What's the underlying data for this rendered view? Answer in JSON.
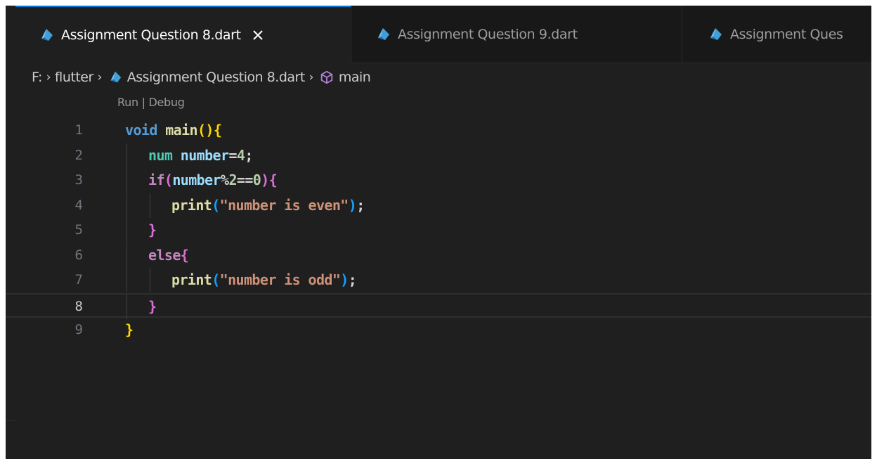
{
  "tabs": [
    {
      "label": "Assignment Question 8.dart",
      "active": true,
      "close_glyph": "✕"
    },
    {
      "label": "Assignment Question 9.dart",
      "active": false
    },
    {
      "label": "Assignment Ques",
      "active": false
    }
  ],
  "breadcrumb": {
    "drive": "F:",
    "folder": "flutter",
    "file": "Assignment Question 8.dart",
    "symbol": "main",
    "separator": "›"
  },
  "codelens": {
    "run": "Run",
    "divider": "|",
    "debug": "Debug"
  },
  "code": {
    "line_numbers": [
      "1",
      "2",
      "3",
      "4",
      "5",
      "6",
      "7",
      "8",
      "9"
    ],
    "current_line": "8",
    "lines": [
      [
        {
          "t": "void",
          "c": "void"
        },
        {
          "t": " ",
          "c": "op"
        },
        {
          "t": "main",
          "c": "fn"
        },
        {
          "t": "()",
          "c": "b1"
        },
        {
          "t": "{",
          "c": "b1"
        }
      ],
      [
        {
          "t": "  ",
          "c": "op"
        },
        {
          "t": "num",
          "c": "ty"
        },
        {
          "t": " ",
          "c": "op"
        },
        {
          "t": "number",
          "c": "id"
        },
        {
          "t": "=",
          "c": "op"
        },
        {
          "t": "4",
          "c": "num"
        },
        {
          "t": ";",
          "c": "op"
        }
      ],
      [
        {
          "t": "  ",
          "c": "op"
        },
        {
          "t": "if",
          "c": "kw"
        },
        {
          "t": "(",
          "c": "b2"
        },
        {
          "t": "number",
          "c": "id"
        },
        {
          "t": "%",
          "c": "op"
        },
        {
          "t": "2",
          "c": "num"
        },
        {
          "t": "==",
          "c": "op"
        },
        {
          "t": "0",
          "c": "num"
        },
        {
          "t": ")",
          "c": "b2"
        },
        {
          "t": "{",
          "c": "b2"
        }
      ],
      [
        {
          "t": "    ",
          "c": "op"
        },
        {
          "t": "print",
          "c": "fn"
        },
        {
          "t": "(",
          "c": "b3"
        },
        {
          "t": "\"number is even\"",
          "c": "str"
        },
        {
          "t": ")",
          "c": "b3"
        },
        {
          "t": ";",
          "c": "op"
        }
      ],
      [
        {
          "t": "  ",
          "c": "op"
        },
        {
          "t": "}",
          "c": "b2"
        }
      ],
      [
        {
          "t": "  ",
          "c": "op"
        },
        {
          "t": "else",
          "c": "kw"
        },
        {
          "t": "{",
          "c": "b2"
        }
      ],
      [
        {
          "t": "    ",
          "c": "op"
        },
        {
          "t": "print",
          "c": "fn"
        },
        {
          "t": "(",
          "c": "b3"
        },
        {
          "t": "\"number is odd\"",
          "c": "str"
        },
        {
          "t": ")",
          "c": "b3"
        },
        {
          "t": ";",
          "c": "op"
        }
      ],
      [
        {
          "t": "  ",
          "c": "op"
        },
        {
          "t": "}",
          "c": "b2"
        }
      ],
      [
        {
          "t": "}",
          "c": "b1"
        }
      ]
    ]
  },
  "icons": {
    "tab_file": "dart-file-icon",
    "tab_close": "close-icon",
    "breadcrumb_file": "dart-file-icon",
    "breadcrumb_symbol": "method-cube-icon"
  },
  "colors": {
    "editor_bg": "#1f1f1f",
    "tab_bar_bg": "#181818",
    "active_tab_accent": "#0078d4",
    "dart_icon": "#3f9fd8"
  }
}
